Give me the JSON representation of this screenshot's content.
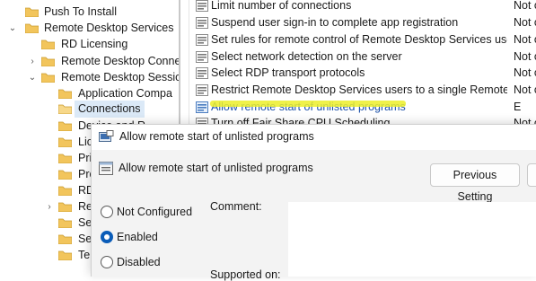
{
  "tree": {
    "items": [
      {
        "label": "Push To Install",
        "chevron": ""
      },
      {
        "label": "Remote Desktop Services",
        "chevron": "⌄"
      },
      {
        "label": "RD Licensing",
        "chevron": ""
      },
      {
        "label": "Remote Desktop Conne",
        "chevron": "›"
      },
      {
        "label": "Remote Desktop Sessio",
        "chevron": "⌄"
      },
      {
        "label": "Application Compa",
        "chevron": ""
      },
      {
        "label": "Connections",
        "chevron": ""
      },
      {
        "label": "Device and R",
        "chevron": ""
      },
      {
        "label": "Lic",
        "chevron": ""
      },
      {
        "label": "Pri",
        "chevron": ""
      },
      {
        "label": "Pro",
        "chevron": ""
      },
      {
        "label": "RD",
        "chevron": ""
      },
      {
        "label": "Re",
        "chevron": "›"
      },
      {
        "label": "Se",
        "chevron": ""
      },
      {
        "label": "Se",
        "chevron": ""
      },
      {
        "label": "Te",
        "chevron": ""
      }
    ]
  },
  "settings": {
    "rows": [
      {
        "name": "Limit number of connections",
        "state": "Not c"
      },
      {
        "name": "Suspend user sign-in to complete app registration",
        "state": "Not c"
      },
      {
        "name": "Set rules for remote control of Remote Desktop Services use...",
        "state": "Not c"
      },
      {
        "name": "Select network detection on the server",
        "state": "Not c"
      },
      {
        "name": "Select RDP transport protocols",
        "state": "Not c"
      },
      {
        "name": "Restrict Remote Desktop Services users to a single Remote D...",
        "state": "Not c"
      },
      {
        "name": "Allow remote start of unlisted programs",
        "state": "E"
      },
      {
        "name": "Turn off Fair Share CPU Scheduling",
        "state": "Not c"
      }
    ]
  },
  "dialog": {
    "window_title": "Allow remote start of unlisted programs",
    "heading": "Allow remote start of unlisted programs",
    "previous_button": "Previous Setting",
    "next_button": "",
    "options": [
      "Not Configured",
      "Enabled",
      "Disabled"
    ],
    "selected_option": "Enabled",
    "comment_label": "Comment:",
    "supported_label": "Supported on:"
  },
  "colors": {
    "accent": "#0a5cb8",
    "highlight_marker": "#ecef2a",
    "folder": "#f2c55c"
  }
}
